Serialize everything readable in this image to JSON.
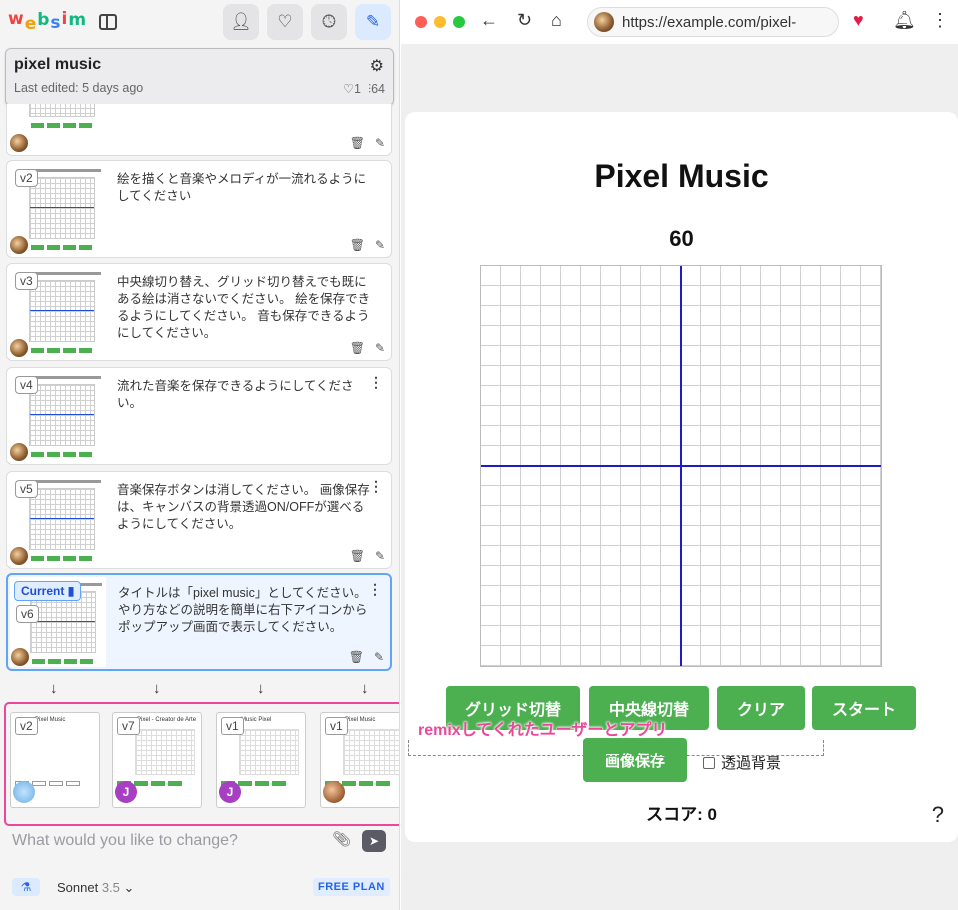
{
  "sidebar": {
    "logo": "websim",
    "project": {
      "title": "pixel music",
      "last_edited": "Last edited: 5 days ago",
      "likes": "♡1",
      "views": "64"
    },
    "versions": [
      {
        "badge": "",
        "text": ""
      },
      {
        "badge": "v2",
        "text": "絵を描くと音楽やメロディが一流れるようにしてください"
      },
      {
        "badge": "v3",
        "text": "中央線切り替え、グリッド切り替えでも既にある絵は消さないでください。 絵を保存できるようにしてください。 音も保存できるようにしてください。"
      },
      {
        "badge": "v4",
        "text": "流れた音楽を保存できるようにしてください。"
      },
      {
        "badge": "v5",
        "text": "音楽保存ボタンは消してください。 画像保存は、キャンバスの背景透過ON/OFFが選べるようにしてください。"
      },
      {
        "badge": "v6",
        "current_label": "Current",
        "text": "タイトルは「pixel music」としてください。 やり方などの説明を簡単に右下アイコンからポップアップ画面で表示してください。"
      }
    ],
    "remixes": [
      {
        "badge": "v2",
        "title": "Pixel Music",
        "avatar": ""
      },
      {
        "badge": "v7",
        "title": "Pixel - Creator de Arte",
        "avatar": "J"
      },
      {
        "badge": "v1",
        "title": "Music Pixel",
        "avatar": "J"
      },
      {
        "badge": "v1",
        "title": "Pixel Music",
        "avatar": ""
      }
    ],
    "prompt": {
      "placeholder": "What would you like to change?",
      "model": "Sonnet",
      "model_version": "3.5",
      "plan": "FREE PLAN"
    }
  },
  "browser": {
    "url": "https://example.com/pixel-"
  },
  "app": {
    "title": "Pixel Music",
    "timer": "60",
    "buttons": {
      "grid_toggle": "グリッド切替",
      "center_toggle": "中央線切替",
      "clear": "クリア",
      "start": "スタート",
      "save_image": "画像保存"
    },
    "transparent_label": "透過背景",
    "score": "スコア: 0",
    "help": "?"
  },
  "annotation": "remixしてくれたユーザーとアプリ",
  "colors": {
    "accent_green": "#4caf50",
    "annotation_pink": "#ec4899",
    "center_line": "#1d1dc8"
  }
}
